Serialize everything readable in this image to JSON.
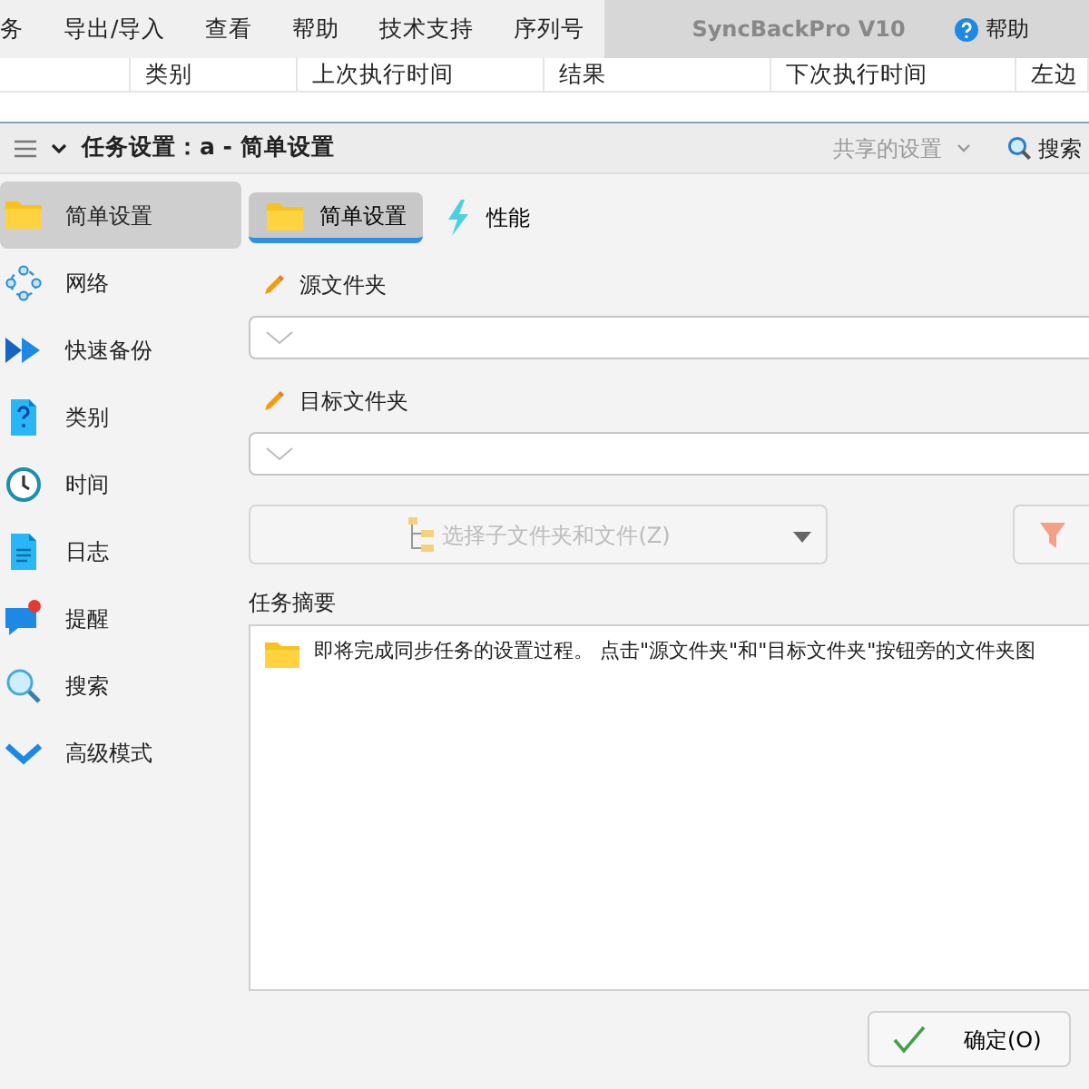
{
  "menu_bar": {
    "items": [
      "务",
      "导出/导入",
      "查看",
      "帮助",
      "技术支持",
      "序列号"
    ],
    "title": "SyncBackPro V10",
    "help": "帮助"
  },
  "table": {
    "columns": [
      "类别",
      "上次执行时间",
      "结果",
      "下次执行时间",
      "左边"
    ]
  },
  "dialog": {
    "title": "任务设置：a - 简单设置",
    "shared_settings": "共享的设置",
    "search": "搜索"
  },
  "sidebar": {
    "items": [
      {
        "label": "简单设置",
        "selected": true
      },
      {
        "label": "网络",
        "selected": false
      },
      {
        "label": "快速备份",
        "selected": false
      },
      {
        "label": "类别",
        "selected": false
      },
      {
        "label": "时间",
        "selected": false
      },
      {
        "label": "日志",
        "selected": false
      },
      {
        "label": "提醒",
        "selected": false
      },
      {
        "label": "搜索",
        "selected": false
      },
      {
        "label": "高级模式",
        "selected": false
      }
    ]
  },
  "tabs": [
    {
      "label": "简单设置",
      "selected": true
    },
    {
      "label": "性能",
      "selected": false
    }
  ],
  "source": {
    "label": "源文件夹"
  },
  "destination": {
    "label": "目标文件夹"
  },
  "subfolder_button": {
    "label": "选择子文件夹和文件(Z)",
    "disabled": true
  },
  "summary": {
    "label": "任务摘要",
    "text": "即将完成同步任务的设置过程。 点击\"源文件夹\"和\"目标文件夹\"按钮旁的文件夹图"
  },
  "ok_button": {
    "label": "确定(O)"
  }
}
